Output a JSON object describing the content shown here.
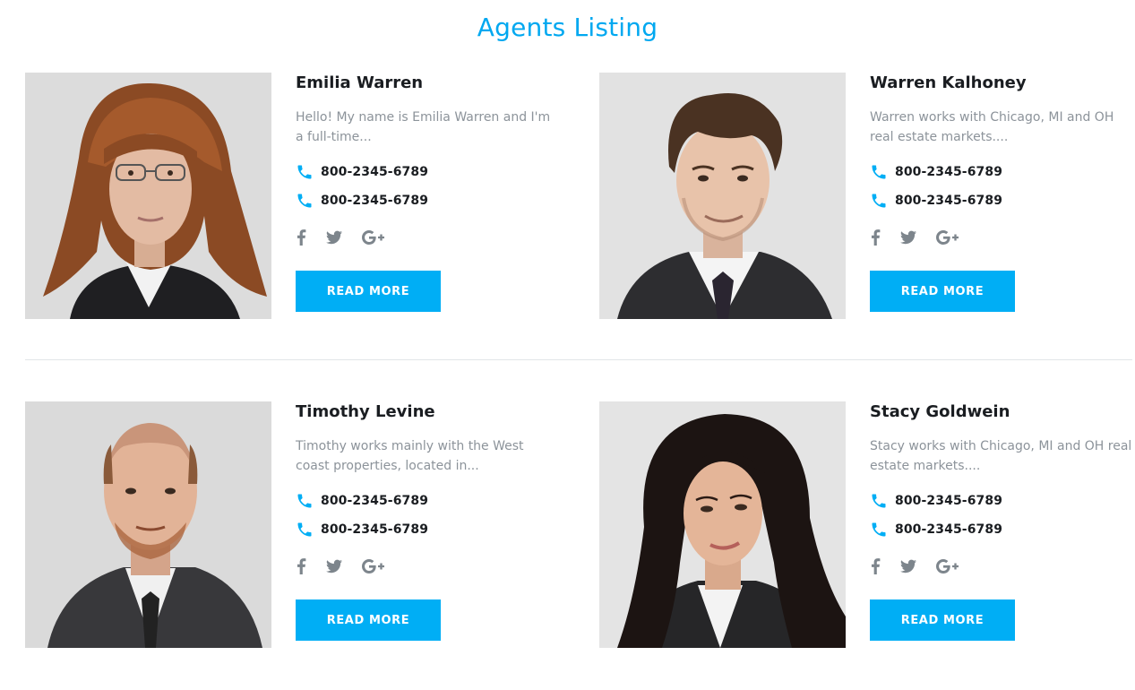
{
  "page": {
    "title": "Agents Listing"
  },
  "colors": {
    "accent": "#00aef5",
    "title": "#00a8f0",
    "text_dark": "#1a1d21",
    "text_muted": "#8c939a",
    "social": "#7d858c"
  },
  "agents": [
    {
      "name": "Emilia Warren",
      "description": "Hello! My name is Emilia Warren and I'm a full-time...",
      "phones": [
        "800-2345-6789",
        "800-2345-6789"
      ],
      "socials": [
        "facebook-icon",
        "twitter-icon",
        "google-plus-icon"
      ],
      "button_label": "READ MORE"
    },
    {
      "name": "Warren Kalhoney",
      "description": "Warren works with Chicago, MI and OH real estate markets....",
      "phones": [
        "800-2345-6789",
        "800-2345-6789"
      ],
      "socials": [
        "facebook-icon",
        "twitter-icon",
        "google-plus-icon"
      ],
      "button_label": "READ MORE"
    },
    {
      "name": "Timothy Levine",
      "description": "Timothy works mainly with the West coast properties, located in...",
      "phones": [
        "800-2345-6789",
        "800-2345-6789"
      ],
      "socials": [
        "facebook-icon",
        "twitter-icon",
        "google-plus-icon"
      ],
      "button_label": "READ MORE"
    },
    {
      "name": "Stacy Goldwein",
      "description": "Stacy works with Chicago, MI and OH real estate markets....",
      "phones": [
        "800-2345-6789",
        "800-2345-6789"
      ],
      "socials": [
        "facebook-icon",
        "twitter-icon",
        "google-plus-icon"
      ],
      "button_label": "READ MORE"
    }
  ]
}
